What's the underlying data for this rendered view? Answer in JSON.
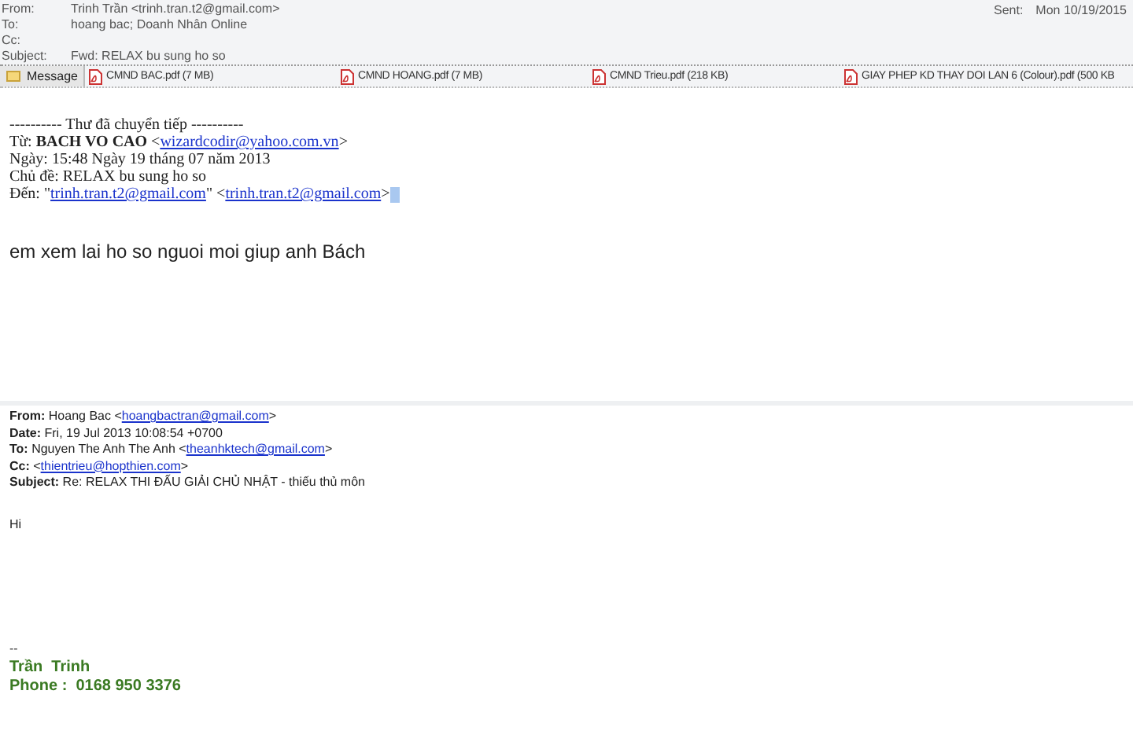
{
  "header": {
    "fields": [
      {
        "label": "From:",
        "value": "Trinh Trần <trinh.tran.t2@gmail.com>"
      },
      {
        "label": "To:",
        "value": "hoang bac; Doanh Nhân Online"
      },
      {
        "label": "Cc:"
      },
      {
        "label": "Subject:",
        "value": "Fwd: RELAX bu sung ho so"
      }
    ],
    "sent": {
      "label": "Sent:",
      "value": "Mon 10/19/2015"
    }
  },
  "attachments": {
    "message_tab": "Message",
    "files": [
      {
        "name": "CMND BAC.pdf (7 MB)"
      },
      {
        "name": "CMND HOANG.pdf (7 MB)"
      },
      {
        "name": "CMND Trieu.pdf (218 KB)"
      },
      {
        "name": "GIAY PHEP KD THAY DOI LAN 6 (Colour).pdf (500 KB"
      }
    ]
  },
  "forwarded": [
    [
      {
        "kind": "text",
        "text": "---------- Thư đã chuyển tiếp ----------"
      }
    ],
    [
      {
        "kind": "text",
        "text": "Từ: **BACH VO CAO** <"
      },
      {
        "kind": "link",
        "text": "wizardcodir@yahoo.com.vn"
      },
      {
        "kind": "text",
        "text": ">"
      }
    ],
    [
      {
        "kind": "text",
        "text": "Ngày: 15:48 Ngày 19 tháng 07 năm 2013"
      }
    ],
    [
      {
        "kind": "text",
        "text": "Chủ đề: RELAX bu sung ho so"
      }
    ],
    [
      {
        "kind": "text",
        "text": "Đến: \""
      },
      {
        "kind": "link",
        "text": "trinh.tran.t2@gmail.com"
      },
      {
        "kind": "text",
        "text": "\" <"
      },
      {
        "kind": "link",
        "text": "trinh.tran.t2@gmail.com"
      },
      {
        "kind": "text",
        "text": ">"
      }
    ]
  ],
  "body": "em xem lai ho so nguoi moi giup anh Bách",
  "quoted": [
    [
      {
        "kind": "text",
        "text": "**From:** Hoang Bac <"
      },
      {
        "kind": "link",
        "text": "hoangbactran@gmail.com"
      },
      {
        "kind": "text",
        "text": ">"
      }
    ],
    [
      {
        "kind": "text",
        "text": "**Date:** Fri, 19 Jul 2013 10:08:54 +0700"
      }
    ],
    [
      {
        "kind": "text",
        "text": "**To:** Nguyen The Anh The Anh <"
      },
      {
        "kind": "link",
        "text": "theanhktech@gmail.com"
      },
      {
        "kind": "text",
        "text": ">"
      }
    ],
    [
      {
        "kind": "text",
        "text": "**Cc:** <"
      },
      {
        "kind": "link",
        "text": "thientrieu@hopthien.com"
      },
      {
        "kind": "text",
        "text": ">"
      }
    ],
    [
      {
        "kind": "text",
        "text": "**Subject:** Re: RELAX THI ĐẤU GIẢI CHỦ NHẬT - thiếu thủ môn"
      }
    ]
  ],
  "greeting": "Hi",
  "signature": {
    "separator": "--",
    "name": "Trần  Trinh",
    "phone": "Phone :  0168 950 3376"
  }
}
